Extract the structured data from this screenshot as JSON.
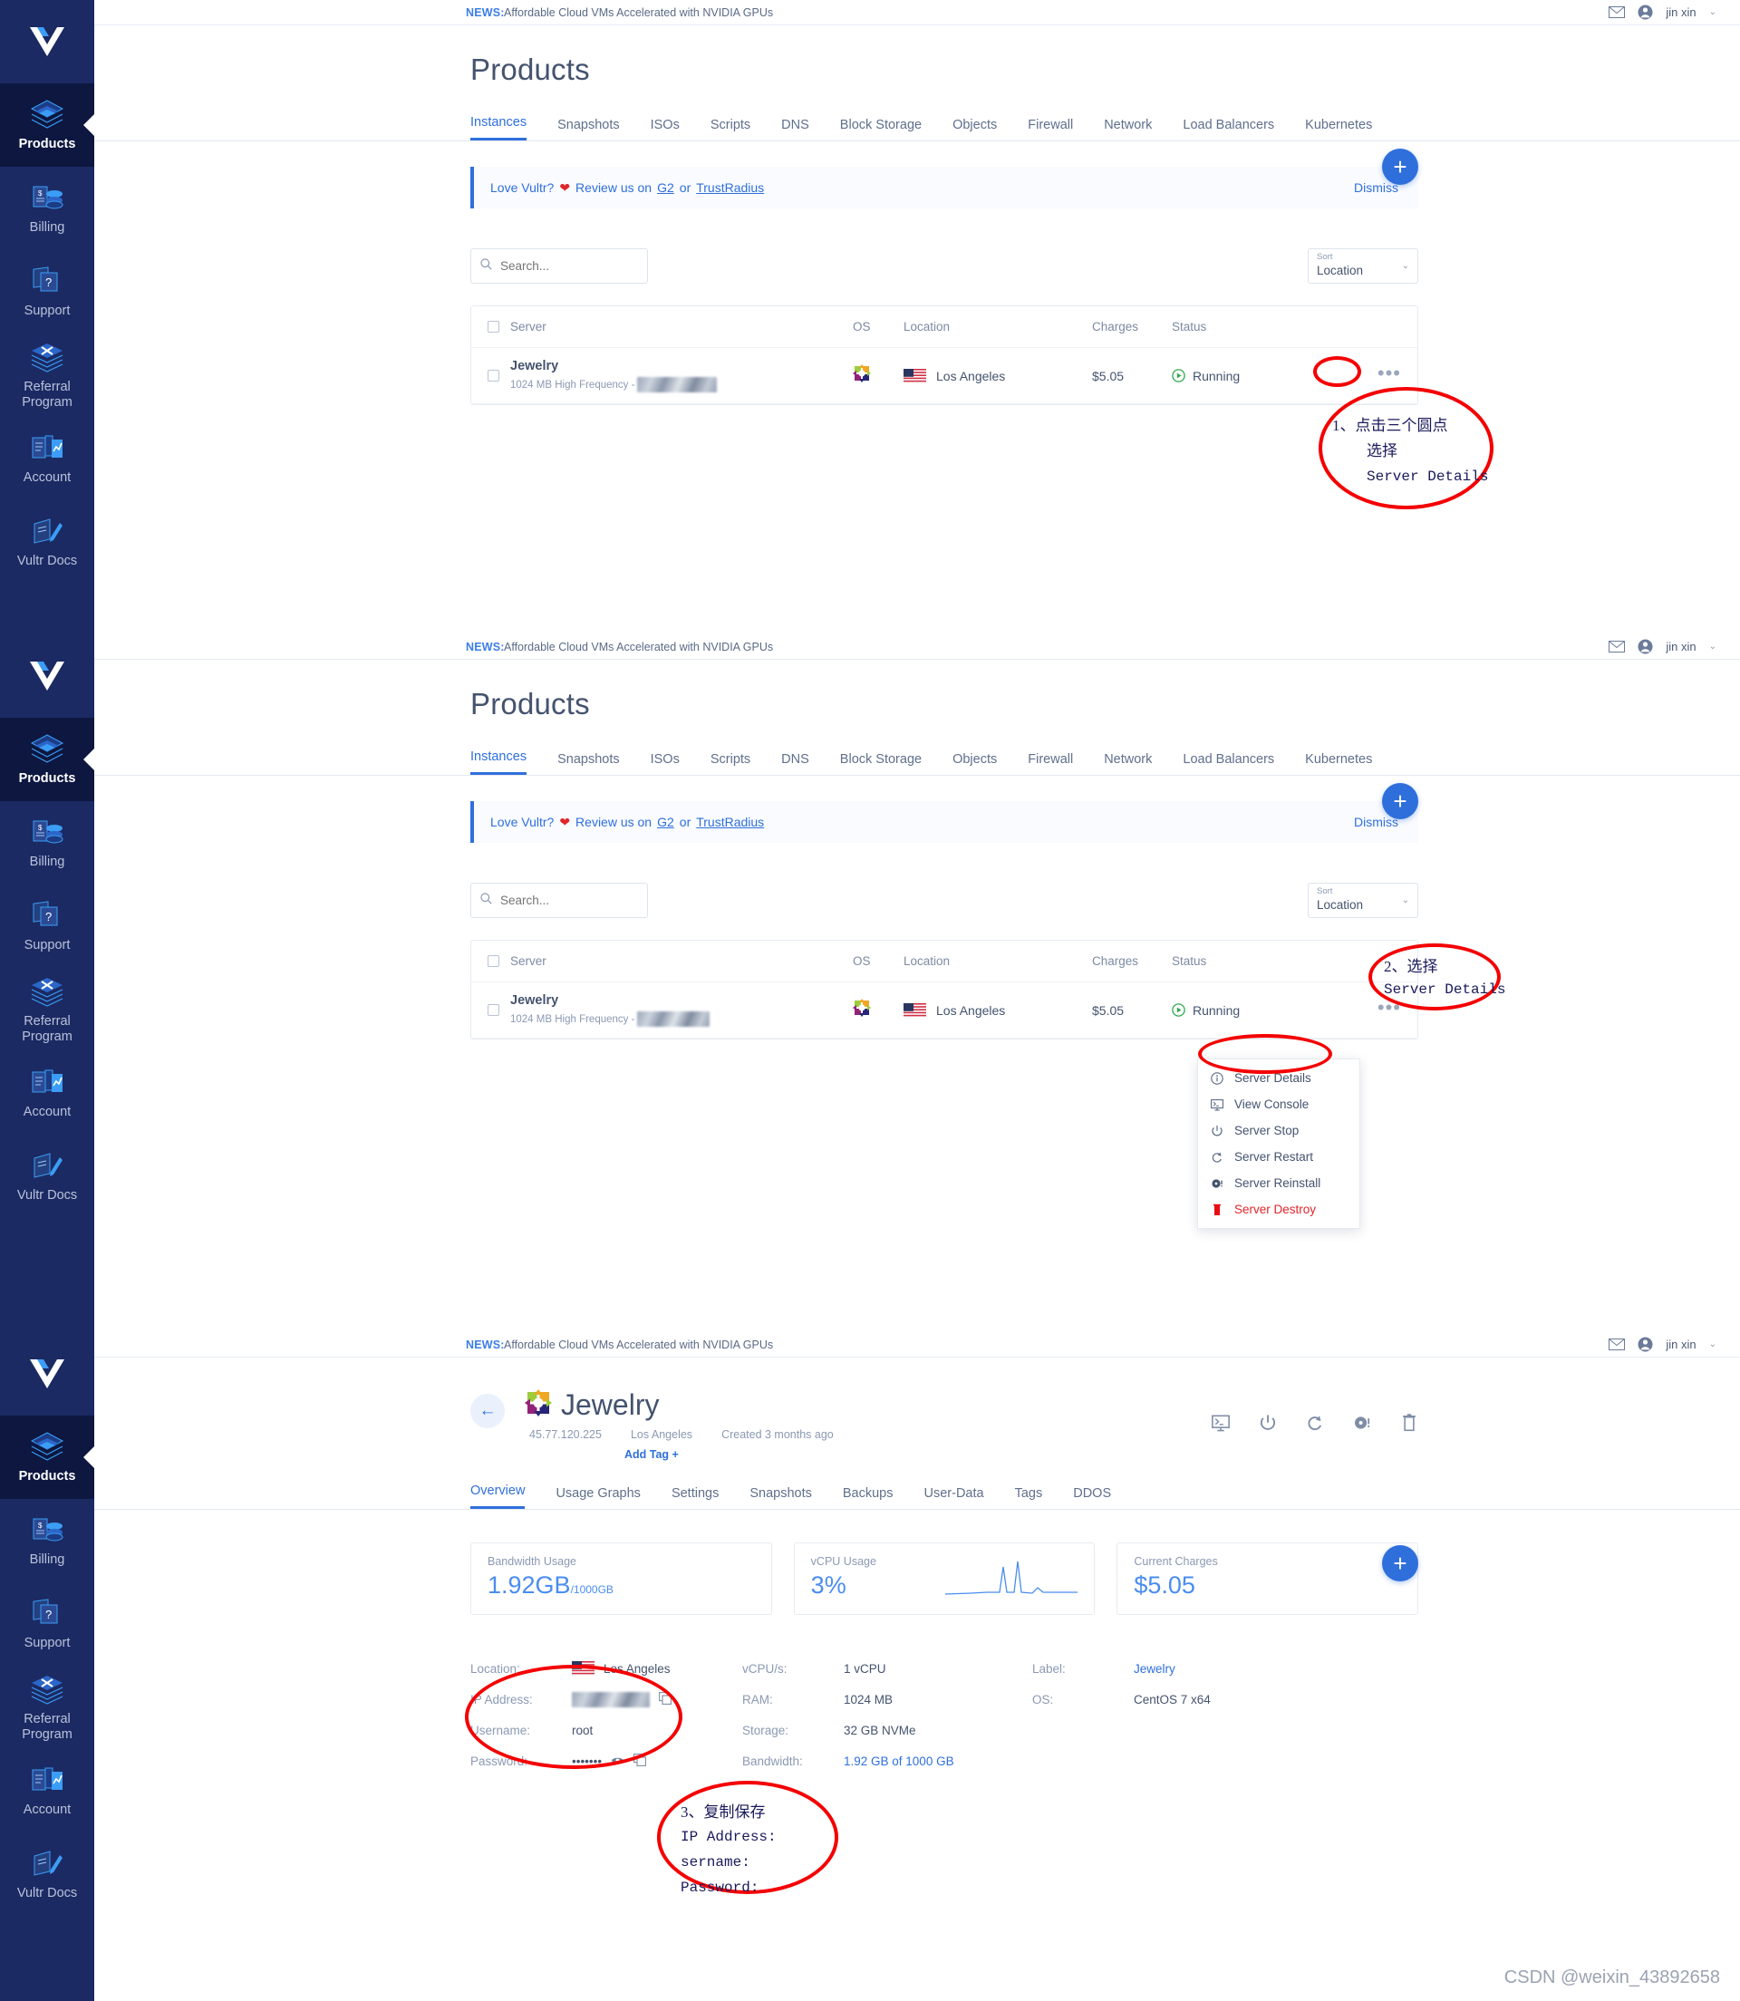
{
  "brand": {
    "name": "Vultr",
    "accent": "#2f6fdc",
    "sidebar_bg": "#1b2a63",
    "danger": "#e0252b",
    "annotation_color": "#f40000"
  },
  "sidebar": {
    "items": [
      {
        "label": "Products",
        "icon": "layers-icon",
        "active": true
      },
      {
        "label": "Billing",
        "icon": "billing-icon",
        "active": false
      },
      {
        "label": "Support",
        "icon": "support-icon",
        "active": false
      },
      {
        "label": "Referral\nProgram",
        "icon": "referral-icon",
        "active": false
      },
      {
        "label": "Account",
        "icon": "account-icon",
        "active": false
      },
      {
        "label": "Vultr Docs",
        "icon": "docs-icon",
        "active": false
      }
    ]
  },
  "topbar": {
    "news_label": "NEWS:",
    "news_text": "Affordable Cloud VMs Accelerated with NVIDIA GPUs",
    "mail_icon": "mail-icon",
    "avatar_icon": "user-avatar-icon",
    "user_name": "jin xin",
    "caret": "⌄"
  },
  "products": {
    "title": "Products",
    "tabs": [
      {
        "label": "Instances",
        "active": true
      },
      {
        "label": "Snapshots",
        "active": false
      },
      {
        "label": "ISOs",
        "active": false
      },
      {
        "label": "Scripts",
        "active": false
      },
      {
        "label": "DNS",
        "active": false
      },
      {
        "label": "Block Storage",
        "active": false
      },
      {
        "label": "Objects",
        "active": false
      },
      {
        "label": "Firewall",
        "active": false
      },
      {
        "label": "Network",
        "active": false
      },
      {
        "label": "Load Balancers",
        "active": false
      },
      {
        "label": "Kubernetes",
        "active": false
      }
    ],
    "promo": {
      "lead": "Love Vultr?",
      "heart": "❤",
      "middle": "Review us on",
      "link1": "G2",
      "or": "or",
      "link2": "TrustRadius",
      "dismiss": "Dismiss"
    },
    "search": {
      "placeholder": "Search...",
      "value": "",
      "icon": "search-icon"
    },
    "sort": {
      "label": "Sort",
      "value": "Location",
      "icon": "chevron-down-icon"
    },
    "table": {
      "columns": [
        "Server",
        "OS",
        "Location",
        "Charges",
        "Status"
      ],
      "rows": [
        {
          "server_name": "Jewelry",
          "server_sub": "1024 MB High Frequency -",
          "server_sub_redacted": true,
          "os": "centos-icon",
          "location": "Los Angeles",
          "location_flag": "us-flag-icon",
          "charges": "$5.05",
          "status": "Running",
          "actions_icon": "ellipsis-icon"
        }
      ]
    },
    "add_button": "+"
  },
  "context_menu": {
    "items": [
      {
        "label": "Server Details",
        "icon": "info-icon",
        "danger": false
      },
      {
        "label": "View Console",
        "icon": "console-icon",
        "danger": false
      },
      {
        "label": "Server Stop",
        "icon": "power-icon",
        "danger": false
      },
      {
        "label": "Server Restart",
        "icon": "restart-icon",
        "danger": false
      },
      {
        "label": "Server Reinstall",
        "icon": "reinstall-icon",
        "danger": false
      },
      {
        "label": "Server Destroy",
        "icon": "trash-icon",
        "danger": true
      }
    ]
  },
  "detail": {
    "back_icon": "arrow-left-icon",
    "os_icon": "centos-icon",
    "title": "Jewelry",
    "ip": "45.77.120.225",
    "location": "Los Angeles",
    "created": "Created 3 months ago",
    "add_tag": "Add Tag +",
    "actions": [
      "console-icon",
      "power-icon",
      "restart-icon",
      "reinstall-icon",
      "trash-icon"
    ],
    "tabs": [
      {
        "label": "Overview",
        "active": true
      },
      {
        "label": "Usage Graphs",
        "active": false
      },
      {
        "label": "Settings",
        "active": false
      },
      {
        "label": "Snapshots",
        "active": false
      },
      {
        "label": "Backups",
        "active": false
      },
      {
        "label": "User-Data",
        "active": false
      },
      {
        "label": "Tags",
        "active": false
      },
      {
        "label": "DDOS",
        "active": false
      }
    ],
    "cards": [
      {
        "label": "Bandwidth Usage",
        "value": "1.92GB",
        "suffix": "/1000GB",
        "spark": false
      },
      {
        "label": "vCPU Usage",
        "value": "3%",
        "suffix": "",
        "spark": true
      },
      {
        "label": "Current Charges",
        "value": "$5.05",
        "suffix": "",
        "spark": false
      }
    ],
    "info_left": [
      {
        "key": "Location:",
        "value": "Los Angeles",
        "flag": "us-flag-icon"
      },
      {
        "key": "IP Address:",
        "value": "",
        "redacted": true,
        "copy": true
      },
      {
        "key": "Username:",
        "value": "root"
      },
      {
        "key": "Password:",
        "value": "•••••••",
        "eye": true,
        "copy": true
      }
    ],
    "info_mid": [
      {
        "key": "vCPU/s:",
        "value": "1 vCPU"
      },
      {
        "key": "RAM:",
        "value": "1024 MB"
      },
      {
        "key": "Storage:",
        "value": "32 GB NVMe"
      },
      {
        "key": "Bandwidth:",
        "value": "1.92 GB of 1000 GB",
        "link": true
      }
    ],
    "info_right": [
      {
        "key": "Label:",
        "value": "Jewelry",
        "link": true
      },
      {
        "key": "OS:",
        "value": "CentOS 7 x64"
      }
    ],
    "add_button": "+"
  },
  "annotations": [
    {
      "id": "anno-1",
      "lines": [
        "1、点击三个圆点",
        "    选择",
        "    Server Details"
      ]
    },
    {
      "id": "anno-2",
      "lines": [
        "2、选择",
        "Server Details"
      ]
    },
    {
      "id": "anno-3",
      "lines": [
        "3、复制保存",
        "IP Address:",
        "sername:",
        "Password:"
      ]
    }
  ],
  "watermark": "CSDN @weixin_43892658"
}
